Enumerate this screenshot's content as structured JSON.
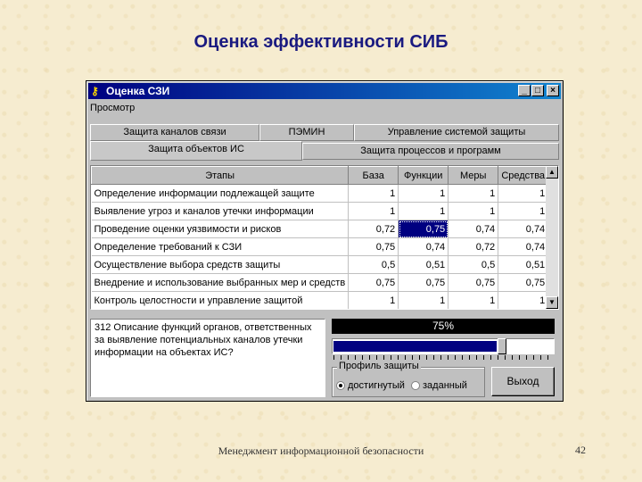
{
  "slide": {
    "title": "Оценка эффективности СИБ",
    "footer": "Менеджмент информационной безопасности",
    "page_number": "42"
  },
  "window": {
    "title": "Оценка СЗИ",
    "buttons": {
      "minimize": "_",
      "maximize": "□",
      "close": "×"
    },
    "menu": {
      "view": "Просмотр"
    },
    "tabs_row1": [
      "Защита каналов связи",
      "ПЭМИН",
      "Управление системой защиты"
    ],
    "tabs_row2": [
      "Защита объектов ИС",
      "Защита процессов и программ"
    ],
    "active_tab": "Защита объектов ИС",
    "table": {
      "headers": [
        "Этапы",
        "База",
        "Функции",
        "Меры",
        "Средства"
      ],
      "rows": [
        [
          "Определение информации подлежащей защите",
          "1",
          "1",
          "1",
          "1"
        ],
        [
          "Выявление угроз и каналов утечки информации",
          "1",
          "1",
          "1",
          "1"
        ],
        [
          "Проведение оценки уязвимости и рисков",
          "0,72",
          "0,75",
          "0,74",
          "0,74"
        ],
        [
          "Определение требований к СЗИ",
          "0,75",
          "0,74",
          "0,72",
          "0,74"
        ],
        [
          "Осуществление выбора средств защиты",
          "0,5",
          "0,51",
          "0,5",
          "0,51"
        ],
        [
          "Внедрение и использование выбранных мер и средств",
          "0,75",
          "0,75",
          "0,75",
          "0,75"
        ],
        [
          "Контроль целостности и управление защитой",
          "1",
          "1",
          "1",
          "1"
        ]
      ],
      "selected_cell": "0,75"
    },
    "description": "312 Описание функций органов, ответственных за выявление потенциальных каналов утечки информации на объектах ИС?",
    "progress": {
      "label": "75%",
      "value": 0.75
    },
    "slider": {
      "value": 0.75
    },
    "protection_profile": {
      "label": "Профиль защиты",
      "options": [
        "достигнутый",
        "заданный"
      ],
      "selected": "достигнутый"
    },
    "exit_label": "Выход"
  }
}
